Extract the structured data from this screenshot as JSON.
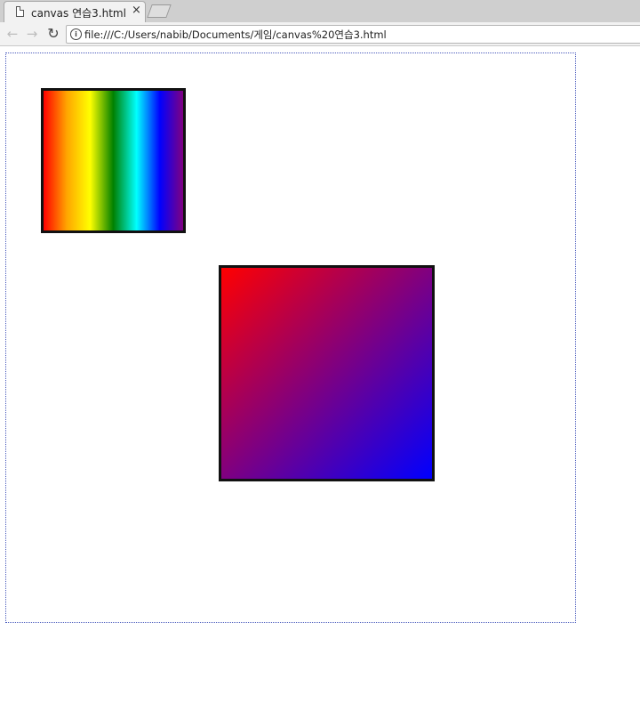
{
  "tab": {
    "title": "canvas  연습3.html",
    "close_label": "×",
    "page_icon": "page-icon"
  },
  "toolbar": {
    "back_icon": "←",
    "forward_icon": "→",
    "reload_icon": "↻",
    "info_icon": "i",
    "url": "file:///C:/Users/nabib/Documents/게임/canvas%20연습3.html"
  },
  "canvas": {
    "border_color": "#4a5bbd",
    "rainbow_stops": [
      "#ff0000",
      "#ffa500",
      "#ffff00",
      "#008000",
      "#00ffff",
      "#0000ff",
      "#800080"
    ],
    "diagonal_from": "#ff0000",
    "diagonal_to": "#0000ff"
  }
}
